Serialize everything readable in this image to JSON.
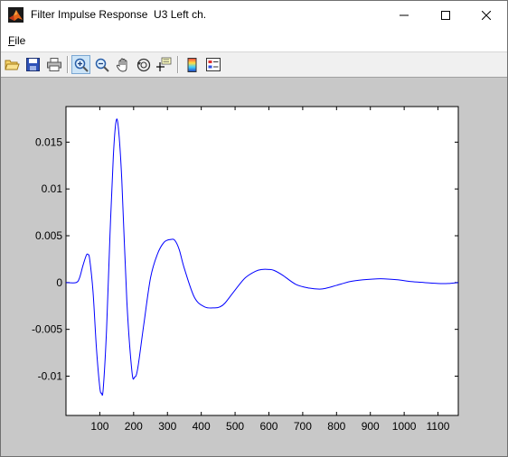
{
  "window": {
    "title": "Filter Impulse Response  U3 Left ch.",
    "icon": "matlab-logo-icon"
  },
  "menu": {
    "file_label": "File",
    "file_mnemonic": "F",
    "file_rest": "ile"
  },
  "toolbar": {
    "buttons": [
      "open-icon",
      "save-icon",
      "print-icon",
      "zoom-in-icon",
      "zoom-out-icon",
      "pan-icon",
      "rotate-icon",
      "data-cursor-icon",
      "colorbar-icon",
      "legend-icon"
    ],
    "active": "zoom-in-icon"
  },
  "colors": {
    "figure_bg": "#c8c8c8",
    "axes_bg": "#ffffff",
    "line": "#0000ff"
  },
  "chart_data": {
    "type": "line",
    "title": "",
    "xlabel": "",
    "ylabel": "",
    "xlim": [
      0,
      1160
    ],
    "ylim": [
      -0.0142,
      0.0188
    ],
    "grid": false,
    "xticks": [
      100,
      200,
      300,
      400,
      500,
      600,
      700,
      800,
      900,
      1000,
      1100
    ],
    "xtick_labels": [
      "100",
      "200",
      "300",
      "400",
      "500",
      "600",
      "700",
      "800",
      "900",
      "1000",
      "1100"
    ],
    "yticks": [
      -0.01,
      -0.005,
      0,
      0.005,
      0.01,
      0.015
    ],
    "ytick_labels": [
      "-0.01",
      "-0.005",
      "0",
      "0.005",
      "0.01",
      "0.015"
    ],
    "series": [
      {
        "color": "#0000ff",
        "x": [
          0,
          30,
          40,
          50,
          60,
          65,
          70,
          80,
          90,
          100,
          105,
          110,
          120,
          130,
          140,
          148,
          155,
          165,
          180,
          195,
          203,
          212,
          230,
          250,
          270,
          290,
          310,
          322,
          335,
          350,
          380,
          410,
          440,
          455,
          470,
          500,
          530,
          560,
          580,
          600,
          615,
          640,
          680,
          720,
          750,
          770,
          800,
          840,
          880,
          920,
          940,
          980,
          1020,
          1060,
          1100,
          1130,
          1160
        ],
        "y": [
          0,
          0,
          0.0005,
          0.0018,
          0.0029,
          0.003,
          0.0025,
          -0.001,
          -0.007,
          -0.0112,
          -0.0118,
          -0.0114,
          -0.005,
          0.005,
          0.0135,
          0.0172,
          0.0165,
          0.011,
          -0.002,
          -0.0095,
          -0.0101,
          -0.0092,
          -0.0045,
          0.0005,
          0.003,
          0.0043,
          0.0046,
          0.0045,
          0.0035,
          0.0015,
          -0.0016,
          -0.0026,
          -0.0027,
          -0.0026,
          -0.0022,
          -0.0008,
          0.0005,
          0.0012,
          0.0014,
          0.0014,
          0.0013,
          0.0008,
          -0.0002,
          -0.0006,
          -0.0007,
          -0.0006,
          -0.0003,
          0.0001,
          0.0003,
          0.0004,
          0.0004,
          0.0003,
          0.0001,
          0.0,
          -0.0001,
          -0.0001,
          0.0
        ]
      }
    ]
  }
}
